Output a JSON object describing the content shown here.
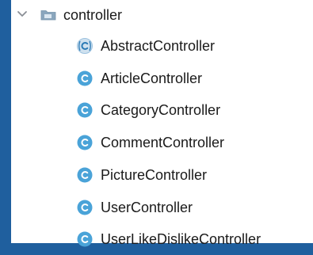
{
  "folder": {
    "name": "controller",
    "expanded": true,
    "icon": "folder-icon",
    "color": "#8aa6bd"
  },
  "classes": [
    {
      "name": "AbstractController",
      "icon": "abstract-class-icon",
      "abstract": true
    },
    {
      "name": "ArticleController",
      "icon": "class-icon",
      "abstract": false
    },
    {
      "name": "CategoryController",
      "icon": "class-icon",
      "abstract": false
    },
    {
      "name": "CommentController",
      "icon": "class-icon",
      "abstract": false
    },
    {
      "name": "PictureController",
      "icon": "class-icon",
      "abstract": false
    },
    {
      "name": "UserController",
      "icon": "class-icon",
      "abstract": false
    },
    {
      "name": "UserLikeDislikeController",
      "icon": "class-icon",
      "abstract": false
    }
  ],
  "colors": {
    "class_icon_fill": "#4aa3d8",
    "class_icon_letter": "#ffffff",
    "abstract_icon_fill": "#cfe1ef",
    "abstract_icon_letter": "#2a79b5",
    "text": "#1a1a1a",
    "background": "#1f5f9e"
  }
}
